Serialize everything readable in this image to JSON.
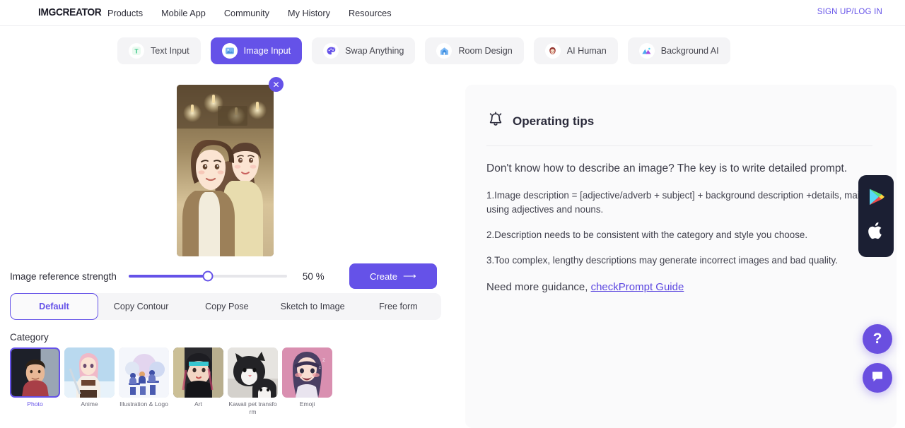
{
  "header": {
    "logo": "IMGCREATOR",
    "nav": [
      {
        "label": "Products"
      },
      {
        "label": "Mobile App"
      },
      {
        "label": "Community"
      },
      {
        "label": "My History"
      },
      {
        "label": "Resources"
      }
    ],
    "auth_label": "SIGN UP/LOG IN"
  },
  "mode_tabs": [
    {
      "label": "Text Input",
      "icon": "text-input-icon",
      "active": false
    },
    {
      "label": "Image Input",
      "icon": "image-input-icon",
      "active": true
    },
    {
      "label": "Swap Anything",
      "icon": "palette-icon",
      "active": false
    },
    {
      "label": "Room Design",
      "icon": "house-icon",
      "active": false
    },
    {
      "label": "AI Human",
      "icon": "person-face-icon",
      "active": false
    },
    {
      "label": "Background AI",
      "icon": "mountain-icon",
      "active": false
    }
  ],
  "workspace": {
    "close_label": "✕",
    "preview_alt": "uploaded reference image of an anime-style couple in a cafe",
    "slider": {
      "label": "Image reference strength",
      "value": 50,
      "value_text": "50 %"
    },
    "create_label": "Create",
    "create_arrow": "⟶"
  },
  "submode_tabs": [
    {
      "label": "Default",
      "active": true
    },
    {
      "label": "Copy Contour",
      "active": false
    },
    {
      "label": "Copy Pose",
      "active": false
    },
    {
      "label": "Sketch to Image",
      "active": false
    },
    {
      "label": "Free form",
      "active": false
    }
  ],
  "category": {
    "title": "Category",
    "items": [
      {
        "label": "Photo",
        "active": true
      },
      {
        "label": "Anime",
        "active": false
      },
      {
        "label": "Illustration & Logo",
        "active": false
      },
      {
        "label": "Art",
        "active": false
      },
      {
        "label": "Kawaii pet transform",
        "active": false
      },
      {
        "label": "Emoji",
        "active": false
      }
    ]
  },
  "tips": {
    "title": "Operating tips",
    "lead": "Don't know how to describe an image? The key is to write detailed prompt.",
    "items": [
      "1.Image description = [adjective/adverb + subject] + background description +details, mainly using adjectives and nouns.",
      "2.Description needs to be consistent with the category and style you choose.",
      "3.Too complex, lengthy descriptions may generate incorrect images and bad quality."
    ],
    "footer_text": "Need more guidance, ",
    "footer_link": "checkPrompt Guide"
  },
  "floating": {
    "store_google": "google-play-icon",
    "store_apple": "apple-icon",
    "help_label": "?",
    "chat_label": "chat-icon"
  },
  "colors": {
    "accent": "#6552e8",
    "accent_soft": "#6a4fe0",
    "panel_bg": "#fafafb",
    "tab_bg": "#f4f4f6",
    "text_dark": "#2b2b36",
    "text_muted": "#6d6d78",
    "store_bg": "#1b1f33"
  }
}
